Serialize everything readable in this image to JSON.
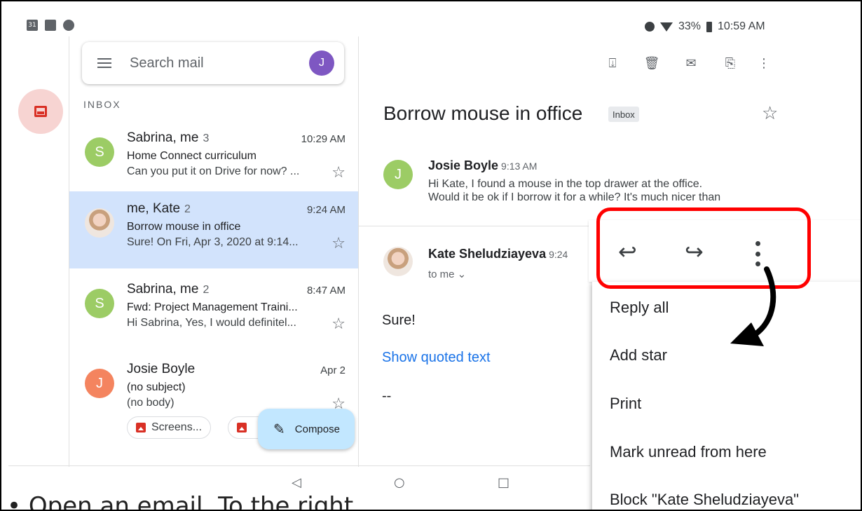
{
  "status_bar": {
    "calendar_icon_text": "31",
    "battery": "33%",
    "time": "10:59 AM"
  },
  "search": {
    "placeholder": "Search mail",
    "avatar_initial": "J"
  },
  "inbox_label": "INBOX",
  "emails": [
    {
      "sender": "Sabrina, me",
      "count": "3",
      "time": "10:29 AM",
      "subject": "Home Connect curriculum",
      "snippet": "Can you put it on Drive for now? ...",
      "avatar": "S"
    },
    {
      "sender": "me, Kate",
      "count": "2",
      "time": "9:24 AM",
      "subject": "Borrow mouse in office",
      "snippet": "Sure! On Fri, Apr 3, 2020 at 9:14...",
      "avatar": ""
    },
    {
      "sender": "Sabrina, me",
      "count": "2",
      "time": "8:47 AM",
      "subject": "Fwd: Project Management Traini...",
      "snippet": "Hi Sabrina, Yes, I would definitel...",
      "avatar": "S"
    },
    {
      "sender": "Josie Boyle",
      "count": "",
      "time": "Apr 2",
      "subject": "(no subject)",
      "snippet": "(no body)",
      "avatar": "J"
    }
  ],
  "attachment_chip": "Screens...",
  "compose_label": "Compose",
  "thread": {
    "subject": "Borrow mouse in office",
    "tag": "Inbox",
    "message1": {
      "avatar": "J",
      "from": "Josie Boyle",
      "time": "9:13 AM",
      "line1": "Hi Kate, I found a mouse in the top drawer at the office.",
      "line2": "Would it be ok if I borrow it for a while? It's much nicer than"
    },
    "message2": {
      "from": "Kate Sheludziayeva",
      "time": "9:24",
      "to": "to me ⌄",
      "body": "Sure!",
      "quoted_link": "Show quoted text",
      "signature": "--"
    }
  },
  "overflow_menu": {
    "items": [
      "Reply all",
      "Add star",
      "Print",
      "Mark unread from here",
      "Block \"Kate Sheludziayeva\""
    ]
  },
  "caption": "Open an email. To the right",
  "colors": {
    "highlight": "#ff0000",
    "selected_row": "#d2e3fc",
    "compose": "#c2e7ff",
    "link": "#1a73e8"
  }
}
